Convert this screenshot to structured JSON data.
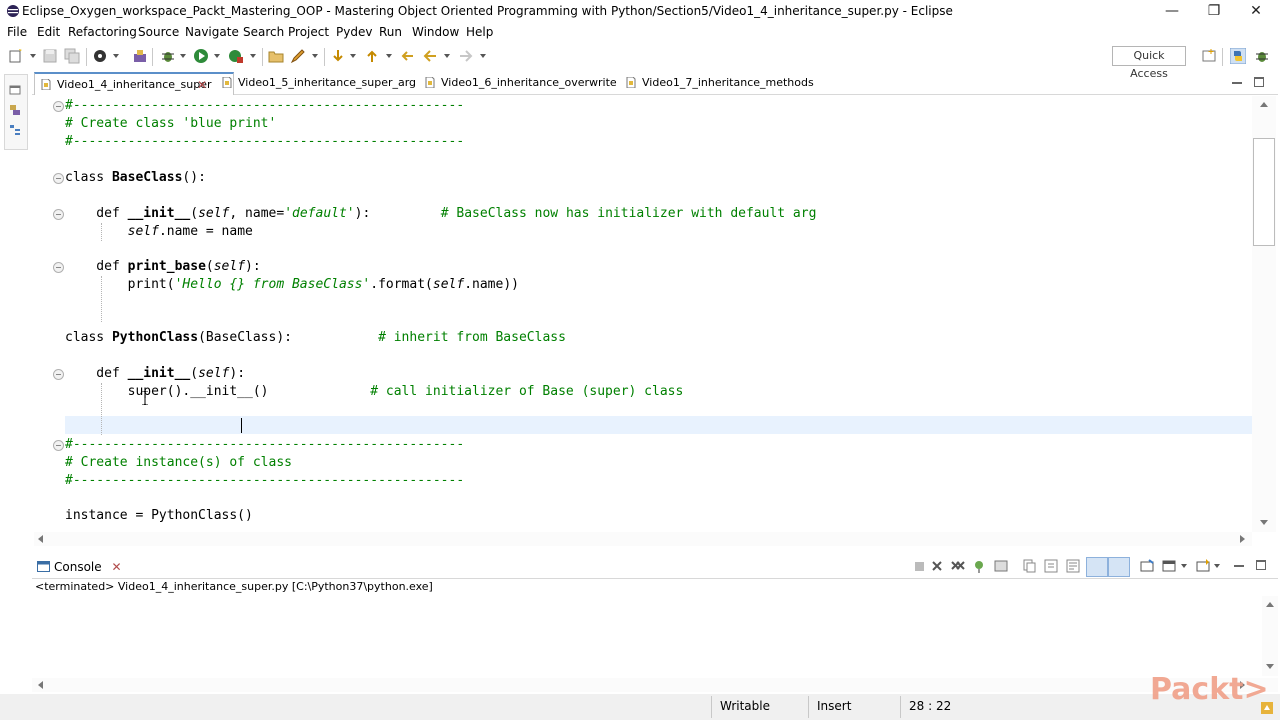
{
  "window": {
    "title": "Eclipse_Oxygen_workspace_Packt_Mastering_OOP - Mastering Object Oriented Programming with Python/Section5/Video1_4_inheritance_super.py - Eclipse",
    "minimize": "—",
    "restore": "❐",
    "close": "✕"
  },
  "menu": [
    "File",
    "Edit",
    "Refactoring",
    "Source",
    "Navigate",
    "Search",
    "Project",
    "Pydev",
    "Run",
    "Window",
    "Help"
  ],
  "toolbar": {
    "quick_access": "Quick Access"
  },
  "editor_tabs": [
    {
      "label": "Video1_4_inheritance_super",
      "active": true,
      "close": "✕"
    },
    {
      "label": "Video1_5_inheritance_super_arg",
      "active": false
    },
    {
      "label": "Video1_6_inheritance_overwrite",
      "active": false
    },
    {
      "label": "Video1_7_inheritance_methods",
      "active": false
    }
  ],
  "code": {
    "l1": "#--------------------------------------------------",
    "l2": "# Create class 'blue print'",
    "l3": "#--------------------------------------------------",
    "l5_kw": "class ",
    "l5_name": "BaseClass",
    "l5_rest": "():",
    "l7_kw": "    def ",
    "l7_name": "__init__",
    "l7_p1": "(",
    "l7_self": "self",
    "l7_p2": ", name=",
    "l7_str": "'default'",
    "l7_p3": "):         ",
    "l7_cmt": "# BaseClass now has initializer with default arg",
    "l8_pre": "        ",
    "l8_self": "self",
    "l8_rest": ".name = name",
    "l10_kw": "    def ",
    "l10_name": "print_base",
    "l10_p1": "(",
    "l10_self": "self",
    "l10_p2": "):",
    "l11_pre": "        print(",
    "l11_str": "'Hello {} from BaseClass'",
    "l11_mid": ".format(",
    "l11_self": "self",
    "l11_end": ".name))",
    "l14_kw": "class ",
    "l14_name": "PythonClass",
    "l14_rest": "(BaseClass):           ",
    "l14_cmt": "# inherit from BaseClass",
    "l16_kw": "    def ",
    "l16_name": "__init__",
    "l16_p1": "(",
    "l16_self": "self",
    "l16_p2": "):",
    "l17_code": "        super().__init__()             ",
    "l17_cmt": "# call initializer of Base (super) class",
    "l19": "#--------------------------------------------------",
    "l20": "# Create instance(s) of class",
    "l21": "#--------------------------------------------------",
    "l23": "instance = PythonClass()"
  },
  "console": {
    "tab_label": "Console",
    "tab_close": "✕",
    "status": "<terminated> Video1_4_inheritance_super.py [C:\\Python37\\python.exe]"
  },
  "statusbar": {
    "writable": "Writable",
    "insert": "Insert",
    "position": "28 : 22"
  },
  "watermark": "Packt>",
  "colors": {
    "comment": "#008000",
    "accent": "#5b8fc9",
    "current_line": "#e8f2fe"
  }
}
